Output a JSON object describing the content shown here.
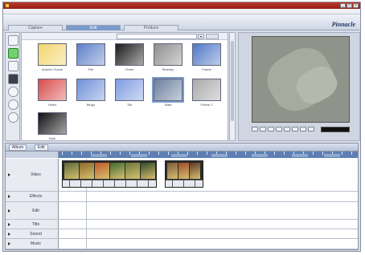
{
  "window": {
    "title": "",
    "controls": [
      "_",
      "□",
      "×"
    ]
  },
  "menu": {
    "items": [
      "",
      "",
      "",
      "",
      "",
      ""
    ]
  },
  "mode_tabs": [
    {
      "label": "Capture"
    },
    {
      "label": "Edit"
    },
    {
      "label": "Produce"
    }
  ],
  "brand": "Pinnacle",
  "library": {
    "dropdown_value": "",
    "button_label": "",
    "thumbnails": [
      {
        "label": "Autumn Scene",
        "color": "#f2d56b"
      },
      {
        "label": "File",
        "color": "#5d7fc8"
      },
      {
        "label": "Cheer",
        "color": "#1b1b1b"
      },
      {
        "label": "Bluesky",
        "color": "#8e8e8e"
      },
      {
        "label": "Frame",
        "color": "#4f78c6"
      },
      {
        "label": "Heart",
        "color": "#d94b4b"
      },
      {
        "label": "Bingo",
        "color": "#6f8fd8"
      },
      {
        "label": "Tile",
        "color": "#7e9be0"
      },
      {
        "label": "Slate",
        "color": "#6c7f9e"
      },
      {
        "label": "Frame 2",
        "color": "#a8a8a8"
      },
      {
        "label": "Dark",
        "color": "#111111"
      }
    ]
  },
  "timeline": {
    "tabs": [
      "Album",
      "Edit"
    ],
    "tracks": [
      {
        "name": "Video"
      },
      {
        "name": "Effects"
      },
      {
        "name": "Edit"
      },
      {
        "name": "Title"
      },
      {
        "name": "Sound"
      },
      {
        "name": "Music"
      }
    ]
  },
  "colors": {
    "accent": "#7a9bcc",
    "ruler": "#5e7fb3",
    "selected_tool": "#6fd46f"
  }
}
